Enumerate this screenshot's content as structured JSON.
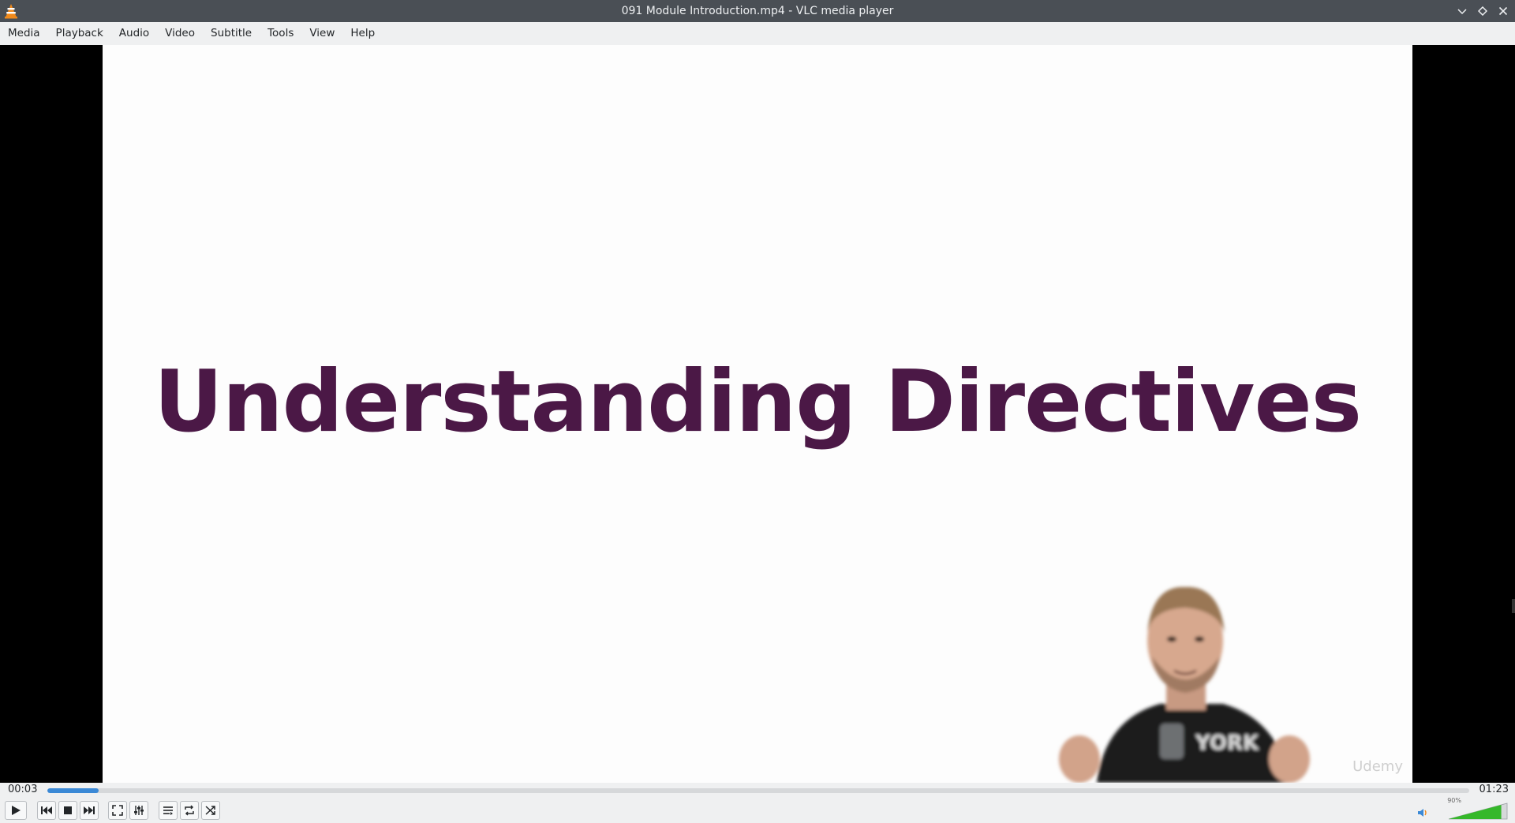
{
  "window": {
    "title": "091 Module Introduction.mp4 - VLC media player",
    "icon": "vlc-cone-icon",
    "controls": [
      "minimize-icon",
      "maximize-icon",
      "close-icon"
    ]
  },
  "menubar": {
    "items": [
      "Media",
      "Playback",
      "Audio",
      "Video",
      "Subtitle",
      "Tools",
      "View",
      "Help"
    ]
  },
  "video": {
    "slide_title": "Understanding Directives",
    "watermark": "Udemy"
  },
  "playback": {
    "elapsed": "00:03",
    "total": "01:23",
    "progress_fraction": 0.036
  },
  "controls": {
    "buttons": [
      "play-icon",
      "previous-icon",
      "stop-icon",
      "next-icon",
      "fullscreen-icon",
      "extended-settings-icon",
      "playlist-icon",
      "loop-icon",
      "shuffle-icon"
    ]
  },
  "volume": {
    "label": "90%",
    "level_fraction": 0.9,
    "accent": "#35b82a"
  },
  "colors": {
    "accent_seek": "#3b89d6",
    "slide_text": "#4b1846"
  }
}
